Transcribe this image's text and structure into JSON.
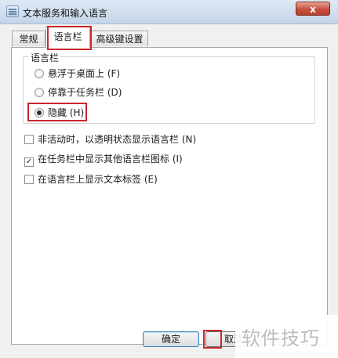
{
  "window": {
    "title": "文本服务和输入语言",
    "close_glyph": "x"
  },
  "tabs": [
    {
      "label": "常规"
    },
    {
      "label": "语言栏"
    },
    {
      "label": "高级键设置"
    }
  ],
  "group": {
    "title": "语言栏",
    "options": [
      {
        "label": "悬浮于桌面上 (F)",
        "selected": false
      },
      {
        "label": "停靠于任务栏 (D)",
        "selected": false
      },
      {
        "label": "隐藏 (H)",
        "selected": true
      }
    ]
  },
  "checkboxes": [
    {
      "label": "非活动时，以透明状态显示语言栏 (N)",
      "checked": false
    },
    {
      "label": "在任务栏中显示其他语言栏图标 (I)",
      "checked": true
    },
    {
      "label": "在语言栏上显示文本标签 (E)",
      "checked": false
    }
  ],
  "buttons": {
    "ok": "确定",
    "cancel": "取消"
  },
  "watermark": "软件技巧",
  "colors": {
    "highlight": "#c8282d"
  }
}
